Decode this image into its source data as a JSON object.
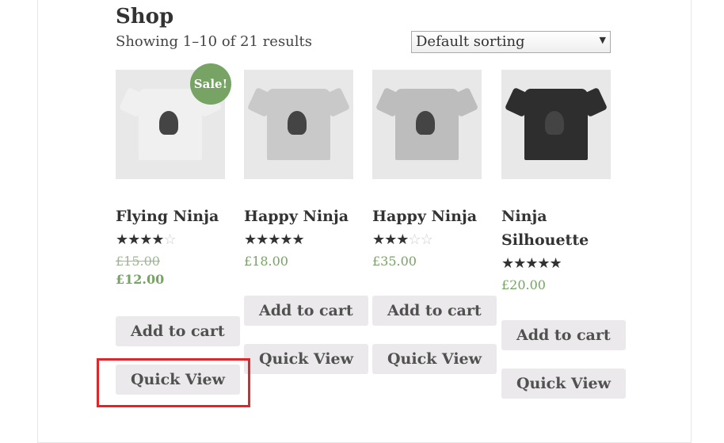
{
  "shop": {
    "title": "Shop",
    "result_count": "Showing 1–10 of 21 results",
    "sorting": "Default sorting"
  },
  "products": [
    {
      "name": "Flying Ninja",
      "rating": 4,
      "old_price": "£15.00",
      "price": "£12.00",
      "sale_badge": "Sale!",
      "add_label": "Add to cart",
      "quick_label": "Quick View",
      "shirt_color": "#f0f0f0"
    },
    {
      "name": "Happy Ninja",
      "rating": 5,
      "price": "£18.00",
      "add_label": "Add to cart",
      "quick_label": "Quick View",
      "shirt_color": "#c9c9c9"
    },
    {
      "name": "Happy Ninja",
      "rating": 3,
      "price": "£35.00",
      "add_label": "Add to cart",
      "quick_label": "Quick View",
      "shirt_color": "#bdbdbd"
    },
    {
      "name": "Ninja Silhouette",
      "rating": 5,
      "price": "£20.00",
      "add_label": "Add to cart",
      "quick_label": "Quick View",
      "shirt_color": "#2e2e2e"
    }
  ],
  "colors": {
    "accent": "#77a464",
    "highlight": "#e0262b"
  }
}
